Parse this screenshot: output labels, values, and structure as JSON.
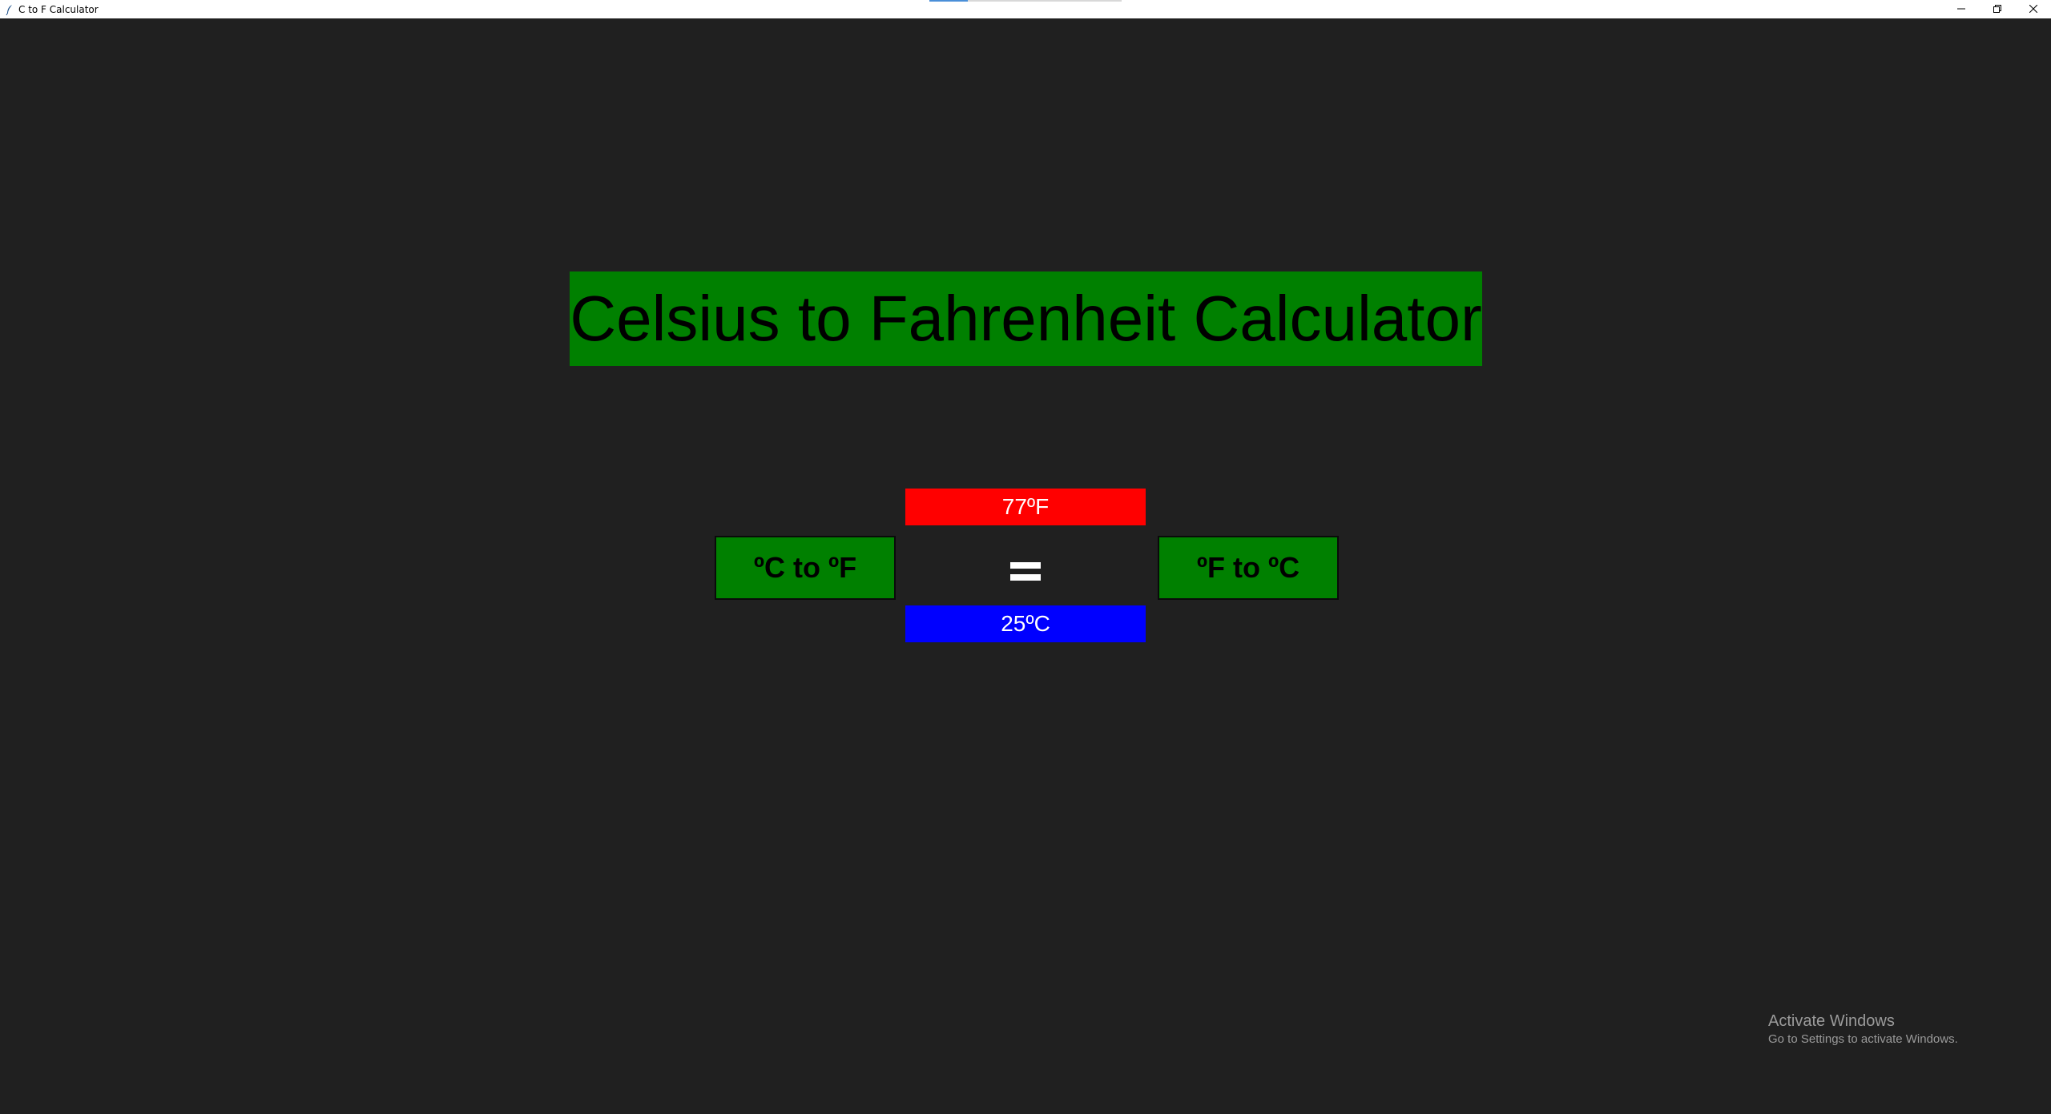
{
  "window": {
    "title": "C to F Calculator",
    "controls": [
      "minimize-icon",
      "restore-icon",
      "close-icon"
    ]
  },
  "app": {
    "heading": "Celsius to Fahrenheit Calculator",
    "fahrenheit_value": "77ºF",
    "celsius_value": "25ºC",
    "c_to_f_label": "ºC to ºF",
    "f_to_c_label": "ºF to ºC",
    "equals_icon": "equals-icon"
  },
  "overlay": {
    "activate_title": "Activate Windows",
    "activate_subtitle": "Go to Settings to activate Windows."
  },
  "colors": {
    "background": "#202020",
    "accent_green": "#008000",
    "fahrenheit_bg": "#ff0000",
    "celsius_bg": "#0000ff"
  }
}
